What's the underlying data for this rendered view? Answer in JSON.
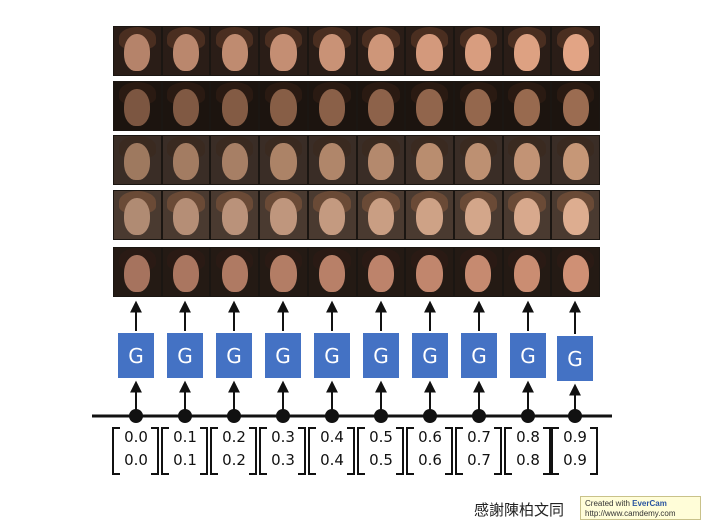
{
  "generator_label": "G",
  "latent_vectors": [
    [
      "0.0",
      "0.0"
    ],
    [
      "0.1",
      "0.1"
    ],
    [
      "0.2",
      "0.2"
    ],
    [
      "0.3",
      "0.3"
    ],
    [
      "0.4",
      "0.4"
    ],
    [
      "0.5",
      "0.5"
    ],
    [
      "0.6",
      "0.6"
    ],
    [
      "0.7",
      "0.7"
    ],
    [
      "0.8",
      "0.8"
    ],
    [
      "0.9",
      "0.9"
    ]
  ],
  "face_rows": [
    {
      "skin": "#c99276",
      "hair": "#4a2e20",
      "bg": "#2a1d17"
    },
    {
      "skin": "#8a6048",
      "hair": "#2a1a12",
      "bg": "#1c140f"
    },
    {
      "skin": "#b0866a",
      "hair": "#3a2a20",
      "bg": "#3a2d26"
    },
    {
      "skin": "#c49a80",
      "hair": "#6a4a36",
      "bg": "#4a3a30"
    },
    {
      "skin": "#b88068",
      "hair": "#2a1a14",
      "bg": "#241a14"
    }
  ],
  "credit_text": "感謝陳柏文同",
  "watermark": {
    "line1_prefix": "Created with ",
    "line1_brand": "EverCam",
    "line2": "http://www.camdemy.com"
  }
}
